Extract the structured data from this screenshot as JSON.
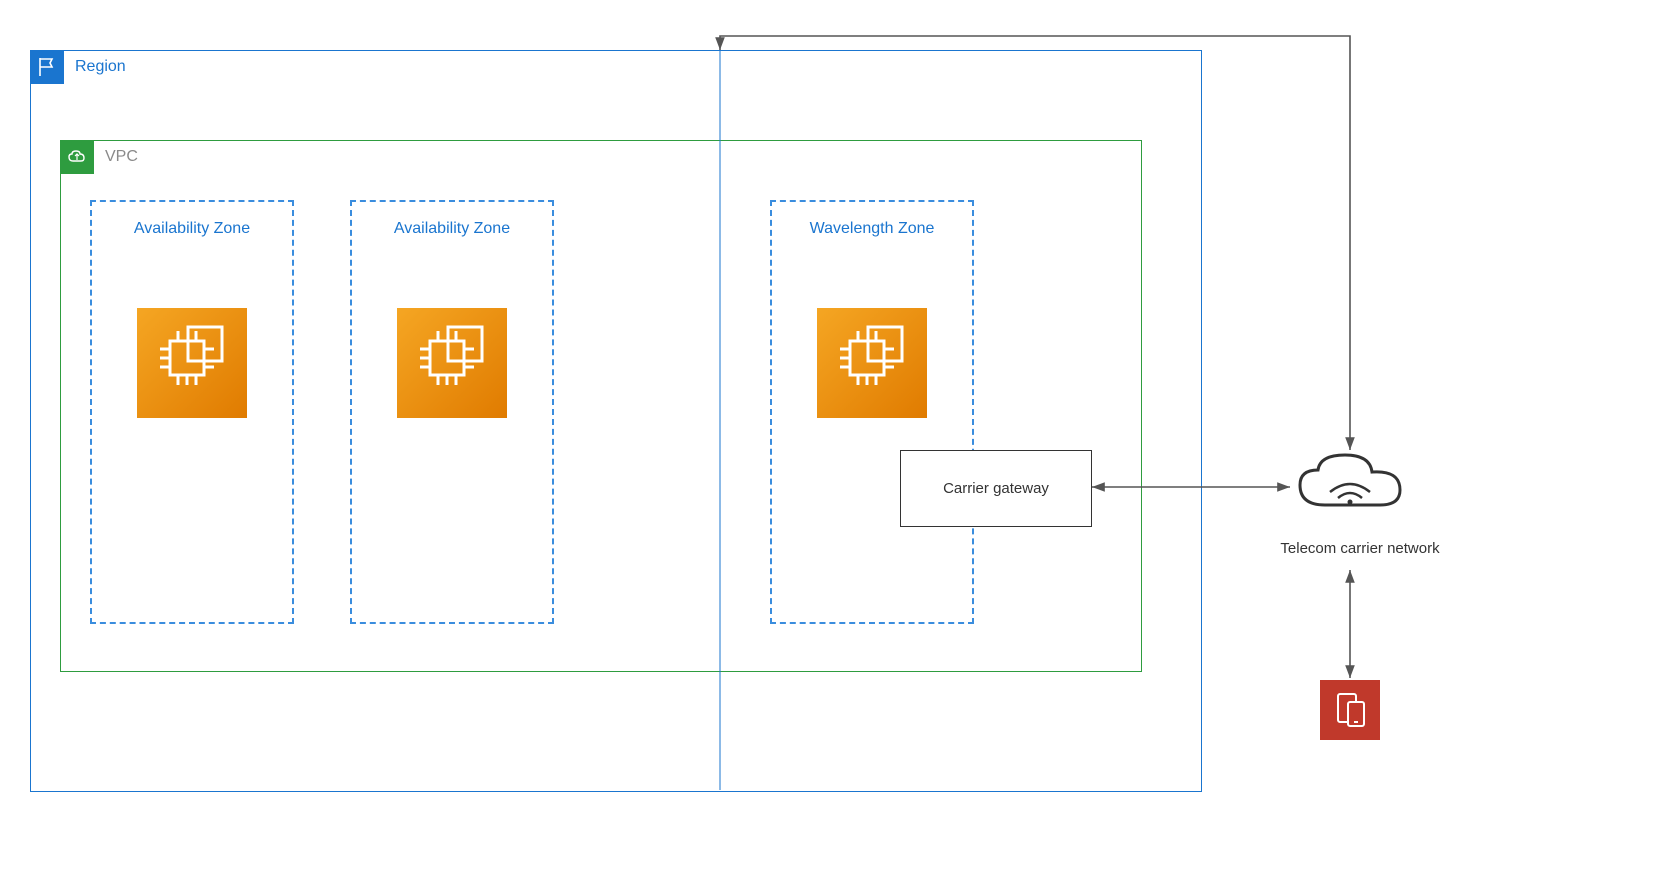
{
  "region": {
    "label": "Region"
  },
  "vpc": {
    "label": "VPC"
  },
  "zones": {
    "az1": "Availability Zone",
    "az2": "Availability Zone",
    "wl": "Wavelength Zone"
  },
  "carrier_gateway": "Carrier gateway",
  "telecom": "Telecom carrier network"
}
